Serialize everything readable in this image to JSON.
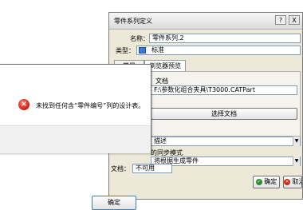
{
  "main_dialog": {
    "title": "零件系列定义",
    "help_button": "?",
    "close_button": "X",
    "name_label": "名称：",
    "name_value": "零件系列.2",
    "type_label": "类型：",
    "type_value": "标准",
    "tabs": [
      "常量",
      "浏览器预览"
    ],
    "document_header": "文档",
    "document_path": "F:\\参数化组合夹具\\T3000.CATPart",
    "select_document_button": "选择文档",
    "description_value": "描述",
    "sync_mode_label": "的同步模式",
    "generate_value": "将根据生成零件",
    "document_label": "文档：",
    "document_status": "不可用",
    "ok_button": "确定",
    "cancel_button": "取消"
  },
  "error_dialog": {
    "message": "未找到任何含“零件编号”列的设计表。",
    "ok_button": "确定"
  },
  "icons": {
    "error": "error-icon",
    "ok": "check-icon",
    "cancel": "cancel-icon",
    "type": "part-icon"
  },
  "colors": {
    "dialog_bg": "#ece9d8",
    "field_border": "#7f9db9",
    "error_red": "#d21a10"
  }
}
